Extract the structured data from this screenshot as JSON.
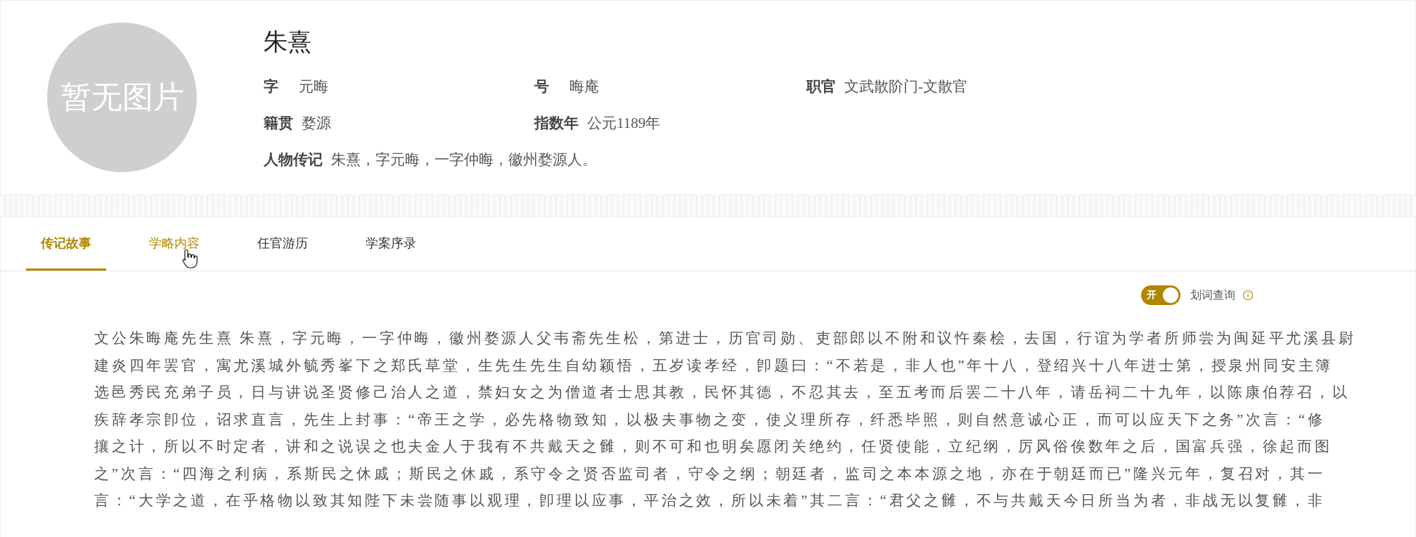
{
  "profile": {
    "avatar_text": "暂无图片",
    "name": "朱熹",
    "fields": [
      {
        "label": "字",
        "value": "元晦"
      },
      {
        "label": "号",
        "value": "晦庵"
      },
      {
        "label": "职官",
        "value": "文武散阶门-文散官"
      },
      {
        "label": "籍贯",
        "value": "婺源"
      },
      {
        "label": "指数年",
        "value": "公元1189年"
      }
    ],
    "biography": {
      "label": "人物传记",
      "value": "朱熹，字元晦，一字仲晦，徽州婺源人。"
    }
  },
  "tabs": [
    {
      "label": "传记故事",
      "selected": true,
      "hovered": false
    },
    {
      "label": "学略内容",
      "selected": false,
      "hovered": true
    },
    {
      "label": "任官游历",
      "selected": false,
      "hovered": false
    },
    {
      "label": "学案序录",
      "selected": false,
      "hovered": false
    }
  ],
  "word_lookup": {
    "toggle_text": "开",
    "on": true,
    "label": "划词查询"
  },
  "content_lines": [
    "文公朱晦庵先生熹 朱熹，字元晦，一字仲晦，徽州婺源人父韦斋先生松，第进士，历官司勋、吏部郎以不附和议忤秦桧，去国，行谊为学者所师尝为闽延平尤溪县尉",
    "建炎四年罢官，寓尤溪城外毓秀峯下之郑氏草堂，生先生先生自幼颖悟，五岁读孝经，卽题曰：“不若是，非人也”年十八，登绍兴十八年进士第，授泉州同安主簿",
    "选邑秀民充弟子员，日与讲说圣贤修己治人之道，禁妇女之为僧道者士思其教，民怀其德，不忍其去，至五考而后罢二十八年，请岳祠二十九年，以陈康伯荐召，以",
    "疾辞孝宗卽位，诏求直言，先生上封事：“帝王之学，必先格物致知，以极夫事物之变，使义理所存，纤悉毕照，则自然意诚心正，而可以应天下之务”次言：“修",
    "攘之计，所以不时定者，讲和之说误之也夫金人于我有不共戴天之雠，则不可和也明矣愿闭关绝约，任贤使能，立纪纲，厉风俗俟数年之后，国富兵强，徐起而图",
    "之”次言：“四海之利病，系斯民之休戚；斯民之休戚，系守令之贤否监司者，守令之纲；朝廷者，监司之本本源之地，亦在于朝廷而已”隆兴元年，复召对，其一",
    "言：“大学之道，在乎格物以致其知陛下未尝随事以观理，卽理以应事，平治之效，所以未着”其二言：“君父之雠，不与共戴天今日所当为者，非战无以复雠，非"
  ]
}
